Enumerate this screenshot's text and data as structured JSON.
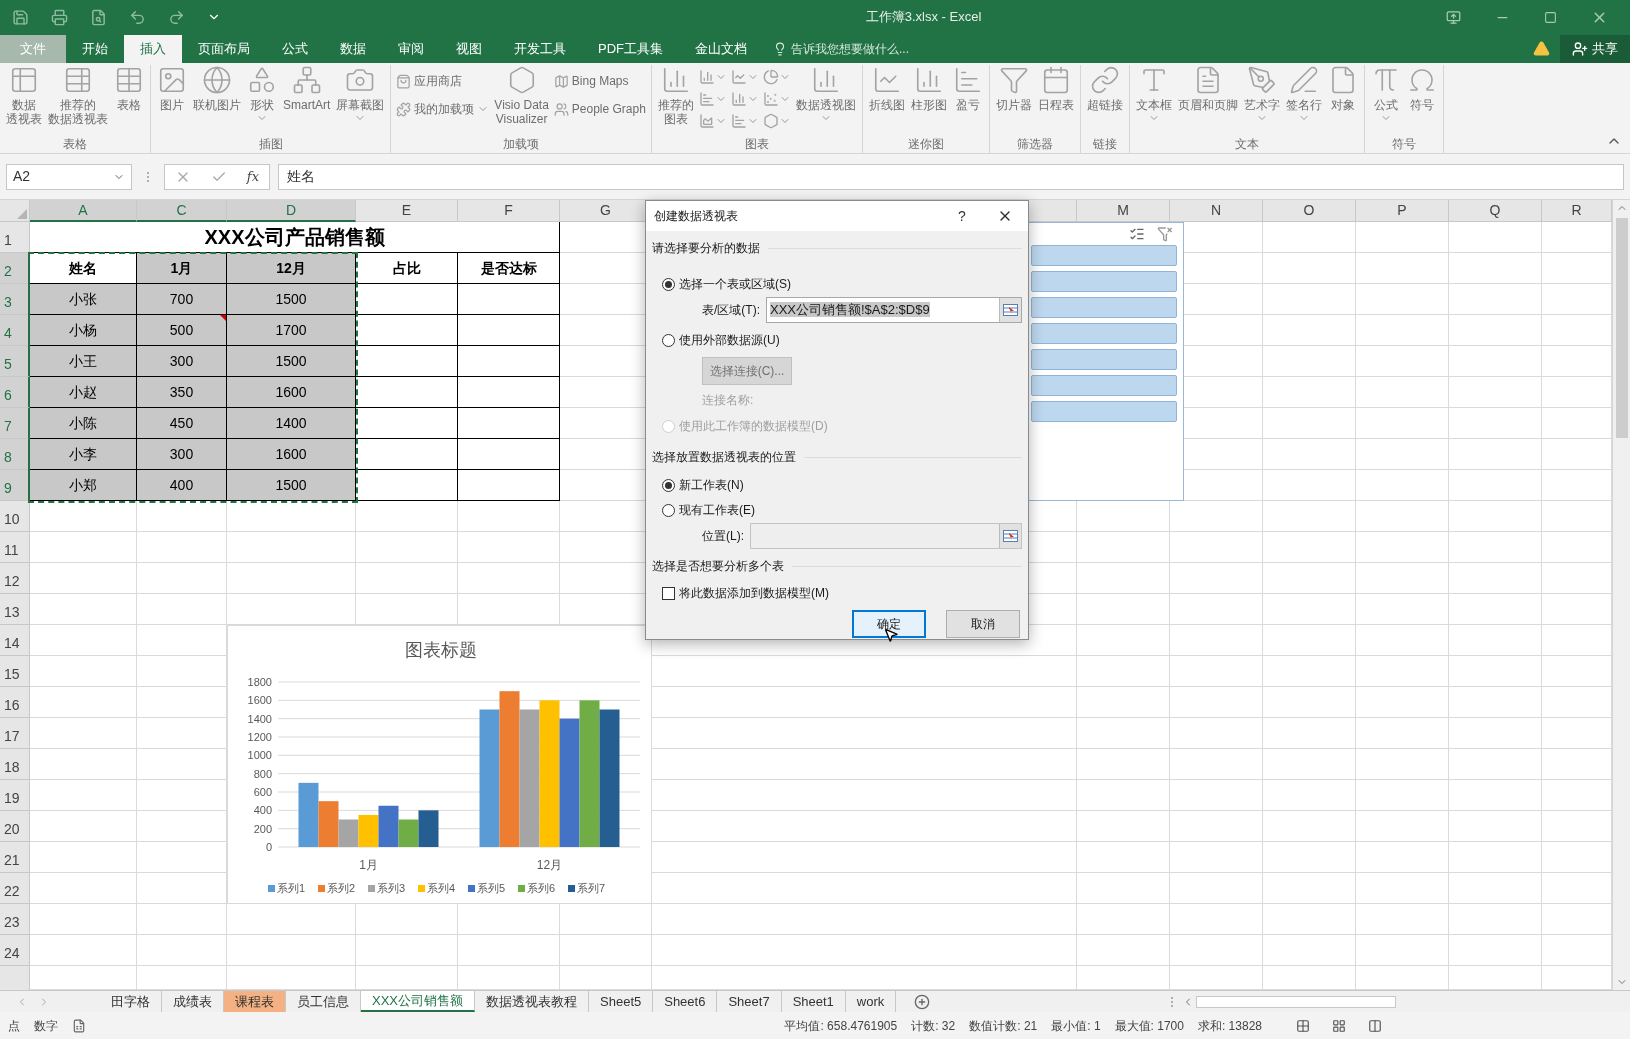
{
  "title_bar": {
    "title": "工作簿3.xlsx - Excel"
  },
  "ribbon_tabs": [
    {
      "label": "文件",
      "kind": "file",
      "selected": false
    },
    {
      "label": "开始",
      "kind": "tab",
      "selected": false
    },
    {
      "label": "插入",
      "kind": "tab",
      "selected": true
    },
    {
      "label": "页面布局",
      "kind": "tab",
      "selected": false
    },
    {
      "label": "公式",
      "kind": "tab",
      "selected": false
    },
    {
      "label": "数据",
      "kind": "tab",
      "selected": false
    },
    {
      "label": "审阅",
      "kind": "tab",
      "selected": false
    },
    {
      "label": "视图",
      "kind": "tab",
      "selected": false
    },
    {
      "label": "开发工具",
      "kind": "tab",
      "selected": false
    },
    {
      "label": "PDF工具集",
      "kind": "tab",
      "selected": false
    },
    {
      "label": "金山文档",
      "kind": "tab",
      "selected": false
    }
  ],
  "tell_me": {
    "placeholder": "告诉我您想要做什么..."
  },
  "share_button": {
    "label": "共享"
  },
  "ribbon_groups": [
    {
      "label": "表格",
      "items": [
        {
          "kind": "large",
          "lines": [
            "数据",
            "透视表"
          ],
          "dropdown": false
        },
        {
          "kind": "large",
          "lines": [
            "推荐的",
            "数据透视表"
          ],
          "dropdown": false
        },
        {
          "kind": "large",
          "lines": [
            "表格"
          ],
          "dropdown": false
        }
      ]
    },
    {
      "label": "插图",
      "items": [
        {
          "kind": "large",
          "lines": [
            "图片"
          ],
          "dropdown": false
        },
        {
          "kind": "large",
          "lines": [
            "联机图片"
          ],
          "dropdown": false
        },
        {
          "kind": "large",
          "lines": [
            "形状"
          ],
          "dropdown": true
        },
        {
          "kind": "large",
          "lines": [
            "SmartArt"
          ],
          "dropdown": false
        },
        {
          "kind": "large",
          "lines": [
            "屏幕截图"
          ],
          "dropdown": true
        }
      ]
    },
    {
      "label": "加载项",
      "items": [
        {
          "kind": "small",
          "label": "应用商店",
          "dropdown": false
        },
        {
          "kind": "small",
          "label": "我的加载项",
          "dropdown": true
        },
        {
          "kind": "large",
          "lines": [
            "Visio Data",
            "Visualizer"
          ],
          "dropdown": false
        },
        {
          "kind": "small",
          "label": "Bing Maps",
          "dropdown": false
        },
        {
          "kind": "small",
          "label": "People Graph",
          "dropdown": false
        }
      ]
    },
    {
      "label": "图表",
      "items": [
        {
          "kind": "large",
          "lines": [
            "推荐的",
            "图表"
          ],
          "dropdown": false
        },
        {
          "kind": "mini",
          "dropdown": true
        },
        {
          "kind": "mini",
          "dropdown": true
        },
        {
          "kind": "mini",
          "dropdown": true
        },
        {
          "kind": "mini",
          "dropdown": true
        },
        {
          "kind": "mini",
          "dropdown": true
        },
        {
          "kind": "mini",
          "dropdown": true
        },
        {
          "kind": "mini",
          "dropdown": true
        },
        {
          "kind": "mini",
          "dropdown": true
        },
        {
          "kind": "mini",
          "dropdown": true
        },
        {
          "kind": "large",
          "lines": [
            "数据透视图"
          ],
          "dropdown": true
        }
      ]
    },
    {
      "label": "迷你图",
      "items": [
        {
          "kind": "large",
          "lines": [
            "折线图"
          ],
          "dropdown": false
        },
        {
          "kind": "large",
          "lines": [
            "柱形图"
          ],
          "dropdown": false
        },
        {
          "kind": "large",
          "lines": [
            "盈亏"
          ],
          "dropdown": false
        }
      ]
    },
    {
      "label": "筛选器",
      "items": [
        {
          "kind": "large",
          "lines": [
            "切片器"
          ],
          "dropdown": false
        },
        {
          "kind": "large",
          "lines": [
            "日程表"
          ],
          "dropdown": false
        }
      ]
    },
    {
      "label": "链接",
      "items": [
        {
          "kind": "large",
          "lines": [
            "超链接"
          ],
          "dropdown": false
        }
      ]
    },
    {
      "label": "文本",
      "items": [
        {
          "kind": "large",
          "lines": [
            "文本框"
          ],
          "dropdown": true
        },
        {
          "kind": "large",
          "lines": [
            "页眉和页脚"
          ],
          "dropdown": false
        },
        {
          "kind": "large",
          "lines": [
            "艺术字"
          ],
          "dropdown": true
        },
        {
          "kind": "large",
          "lines": [
            "签名行"
          ],
          "dropdown": true
        },
        {
          "kind": "large",
          "lines": [
            "对象"
          ],
          "dropdown": false
        }
      ]
    },
    {
      "label": "符号",
      "items": [
        {
          "kind": "large",
          "lines": [
            "公式"
          ],
          "dropdown": true
        },
        {
          "kind": "large",
          "lines": [
            "符号"
          ],
          "dropdown": false
        }
      ]
    }
  ],
  "formula_bar": {
    "name_box": "A2",
    "insert_function": "fx",
    "formula": "姓名"
  },
  "sheet": {
    "columns": [
      {
        "label": "A",
        "selected": true
      },
      {
        "label": "C",
        "selected": true
      },
      {
        "label": "D",
        "selected": true
      },
      {
        "label": "E",
        "selected": false
      },
      {
        "label": "F",
        "selected": false
      },
      {
        "label": "G",
        "selected": false
      },
      {
        "label": "M",
        "selected": false
      },
      {
        "label": "N",
        "selected": false
      },
      {
        "label": "O",
        "selected": false
      },
      {
        "label": "P",
        "selected": false
      },
      {
        "label": "Q",
        "selected": false
      },
      {
        "label": "R",
        "selected": false
      }
    ],
    "rows": [
      {
        "label": "1",
        "selected": false
      },
      {
        "label": "2",
        "selected": true
      },
      {
        "label": "3",
        "selected": true
      },
      {
        "label": "4",
        "selected": true
      },
      {
        "label": "5",
        "selected": true
      },
      {
        "label": "6",
        "selected": true
      },
      {
        "label": "7",
        "selected": true
      },
      {
        "label": "8",
        "selected": true
      },
      {
        "label": "9",
        "selected": true
      },
      {
        "label": "10",
        "selected": false
      },
      {
        "label": "11",
        "selected": false
      },
      {
        "label": "12",
        "selected": false
      },
      {
        "label": "13",
        "selected": false
      },
      {
        "label": "14",
        "selected": false
      },
      {
        "label": "15",
        "selected": false
      },
      {
        "label": "16",
        "selected": false
      },
      {
        "label": "17",
        "selected": false
      },
      {
        "label": "18",
        "selected": false
      },
      {
        "label": "19",
        "selected": false
      },
      {
        "label": "20",
        "selected": false
      },
      {
        "label": "21",
        "selected": false
      },
      {
        "label": "22",
        "selected": false
      },
      {
        "label": "23",
        "selected": false
      },
      {
        "label": "24",
        "selected": false
      }
    ],
    "table": {
      "selected": true,
      "title": "XXX公司产品销售额",
      "headers": [
        "姓名",
        "1月",
        "12月",
        "占比",
        "是否达标"
      ],
      "rows": [
        {
          "cells": [
            {
              "text": "小张",
              "comment": false
            },
            {
              "text": "700",
              "comment": false
            },
            {
              "text": "1500",
              "comment": false
            }
          ]
        },
        {
          "cells": [
            {
              "text": "小杨",
              "comment": false
            },
            {
              "text": "500",
              "comment": true
            },
            {
              "text": "1700",
              "comment": false
            }
          ]
        },
        {
          "cells": [
            {
              "text": "小王",
              "comment": false
            },
            {
              "text": "300",
              "comment": false
            },
            {
              "text": "1500",
              "comment": false
            }
          ]
        },
        {
          "cells": [
            {
              "text": "小赵",
              "comment": false
            },
            {
              "text": "350",
              "comment": false
            },
            {
              "text": "1600",
              "comment": false
            }
          ]
        },
        {
          "cells": [
            {
              "text": "小陈",
              "comment": false
            },
            {
              "text": "450",
              "comment": false
            },
            {
              "text": "1400",
              "comment": false
            }
          ]
        },
        {
          "cells": [
            {
              "text": "小李",
              "comment": false
            },
            {
              "text": "300",
              "comment": false
            },
            {
              "text": "1600",
              "comment": false
            }
          ]
        },
        {
          "cells": [
            {
              "text": "小郑",
              "comment": false
            },
            {
              "text": "400",
              "comment": false
            },
            {
              "text": "1500",
              "comment": false
            }
          ]
        }
      ]
    },
    "chart": {
      "chart_data": {
        "type": "bar",
        "title": "图表标题",
        "categories": [
          "1月",
          "12月"
        ],
        "series": [
          {
            "name": "系列1",
            "color": "#5b9bd5",
            "values": [
              700,
              1500
            ]
          },
          {
            "name": "系列2",
            "color": "#ed7d31",
            "values": [
              500,
              1700
            ]
          },
          {
            "name": "系列3",
            "color": "#a5a5a5",
            "values": [
              300,
              1500
            ]
          },
          {
            "name": "系列4",
            "color": "#ffc000",
            "values": [
              350,
              1600
            ]
          },
          {
            "name": "系列5",
            "color": "#4472c4",
            "values": [
              450,
              1400
            ]
          },
          {
            "name": "系列6",
            "color": "#70ad47",
            "values": [
              300,
              1600
            ]
          },
          {
            "name": "系列7",
            "color": "#255e91",
            "values": [
              400,
              1500
            ]
          }
        ],
        "ylim": [
          0,
          1800
        ],
        "yticks": [
          0,
          200,
          400,
          600,
          800,
          1000,
          1200,
          1400,
          1600,
          1800
        ],
        "grid": true,
        "legend": "bottom"
      }
    },
    "slicer": {
      "items": [
        {
          "selected": true
        },
        {
          "selected": true
        },
        {
          "selected": true
        },
        {
          "selected": true
        },
        {
          "selected": true
        },
        {
          "selected": true
        },
        {
          "selected": true
        }
      ]
    }
  },
  "dialog": {
    "title": "创建数据透视表",
    "help_button": "?",
    "source_heading": "请选择要分析的数据",
    "source_options": [
      {
        "label": "选择一个表或区域(S)",
        "selected": true,
        "disabled": false
      },
      {
        "label": "使用外部数据源(U)",
        "selected": false,
        "disabled": false
      },
      {
        "label": "使用此工作簿的数据模型(D)",
        "selected": false,
        "disabled": true
      }
    ],
    "range_field": {
      "label": "表/区域(T):",
      "value": "XXX公司销售额!$A$2:$D$9",
      "highlighted": true
    },
    "connection_button": {
      "label": "选择连接(C)...",
      "disabled": true
    },
    "connection_name": {
      "label": "连接名称:",
      "disabled": true
    },
    "location_heading": "选择放置数据透视表的位置",
    "location_options": [
      {
        "label": "新工作表(N)",
        "selected": true
      },
      {
        "label": "现有工作表(E)",
        "selected": false
      }
    ],
    "location_field": {
      "label": "位置(L):",
      "disabled": true
    },
    "multi_heading": "选择是否想要分析多个表",
    "data_model_checkbox": {
      "label": "将此数据添加到数据模型(M)",
      "checked": false
    },
    "buttons": [
      {
        "label": "确定",
        "default": true
      },
      {
        "label": "取消",
        "default": false
      }
    ]
  },
  "sheet_tabs": [
    {
      "label": "田字格",
      "selected": false
    },
    {
      "label": "成绩表",
      "selected": false
    },
    {
      "label": "课程表",
      "selected": false,
      "color": "#f4b183"
    },
    {
      "label": "员工信息",
      "selected": false
    },
    {
      "label": "XXX公司销售额",
      "selected": true
    },
    {
      "label": "数据透视表教程",
      "selected": false
    },
    {
      "label": "Sheet5",
      "selected": false
    },
    {
      "label": "Sheet6",
      "selected": false
    },
    {
      "label": "Sheet7",
      "selected": false
    },
    {
      "label": "Sheet1",
      "selected": false
    },
    {
      "label": "work",
      "selected": false
    }
  ],
  "status_bar": {
    "cell_mode": "点",
    "num_lock": "数字",
    "stats": [
      "平均值: 658.4761905",
      "计数: 32",
      "数值计数: 21",
      "最小值: 1",
      "最大值: 1700",
      "求和: 13828"
    ]
  }
}
